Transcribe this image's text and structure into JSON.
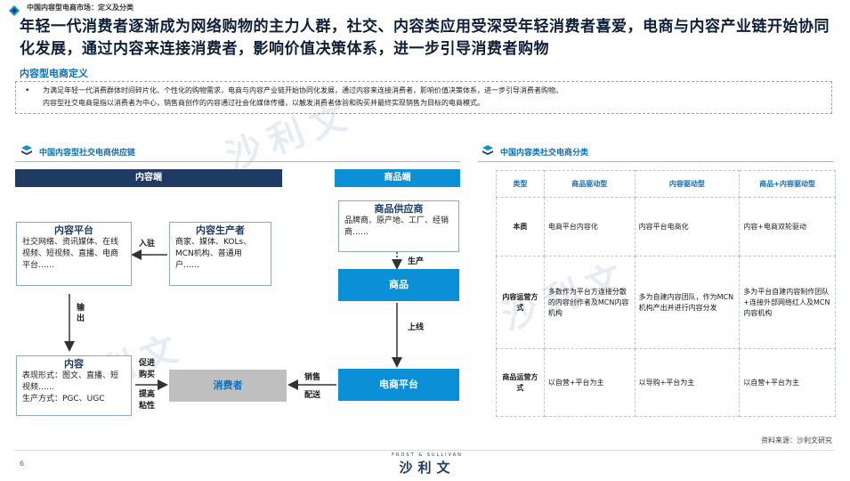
{
  "header": {
    "breadcrumb": "中国内容型电商市场：定义及分类",
    "title": "年轻一代消费者逐渐成为网络购物的主力人群，社交、内容类应用受深受年轻消费者喜爱，电商与内容产业链开始协同化发展，通过内容来连接消费者，影响价值决策体系，进一步引导消费者购物"
  },
  "definition": {
    "label": "内容型电商定义",
    "bullet": "•",
    "lines": [
      "为满足年轻一代消费群体时间碎片化、个性化的购物需求，电商与内容产业链开始协同化发展，通过内容来连接消费者，影响价值决策体系，进一步引导消费者购物。",
      "内容型社交电商是指以消费者为中心，销售商创作的内容通过社会化媒体传播，以触发消费者体验和购买并最终实现销售为目标的电商模式。"
    ]
  },
  "left_section": {
    "title": "中国内容型社交电商供应链",
    "content_side": "内容端",
    "product_side": "商品端",
    "nodes": {
      "content_platform": {
        "title": "内容平台",
        "body": "社交网络、资讯媒体、在线视频、短视频、直播、电商平台……"
      },
      "content_producer": {
        "title": "内容生产者",
        "body": "商家、媒体、KOLs、MCN机构、普通用户……"
      },
      "supplier": {
        "title": "商品供应商",
        "body": "品牌商、原产地、工厂、经销商……"
      },
      "product": {
        "title": "商品"
      },
      "content": {
        "title": "内容",
        "body1": "表现形式：图文、直播、短视频……",
        "body2": "生产方式：PGC、UGC"
      },
      "consumer": {
        "title": "消费者"
      },
      "ecommerce": {
        "title": "电商平台"
      }
    },
    "labels": {
      "enter": "入驻",
      "output": "输出",
      "produce": "生产",
      "listing": "上线",
      "promote_buy": "促进购买",
      "improve_stickiness": "提高粘性",
      "sales_delivery": "销售配送"
    }
  },
  "right_section": {
    "title": "中国内容类社交电商分类",
    "columns": [
      "类型",
      "商品驱动型",
      "内容驱动型",
      "商品+内容驱动型"
    ],
    "rows": [
      {
        "head": "本质",
        "cells": [
          "电商平台内容化",
          "内容平台电商化",
          "内容+电商双轮驱动"
        ]
      },
      {
        "head": "内容运营方式",
        "cells": [
          "多数作为平台方连接分散的内容创作者及MCN内容机构",
          "多为自建内容团队，作为MCN机构产出并进行内容分发",
          "多为平台自建内容制作团队+连接外部网络红人及MCN内容机构"
        ]
      },
      {
        "head": "商品运营方式",
        "cells": [
          "以自营+平台为主",
          "以导购+平台为主",
          "以自营+平台为主"
        ]
      }
    ]
  },
  "footer": {
    "source": "资料来源：沙利文研究",
    "page": "6",
    "logo_top": "FROST & SULLIVAN",
    "logo_main": "沙利文"
  },
  "colors": {
    "brand_dark": "#1f3b63",
    "accent_cyan": "#0b8fd6",
    "accent_blue": "#0b6fb8",
    "consumer_gray": "#bfbfbf"
  }
}
